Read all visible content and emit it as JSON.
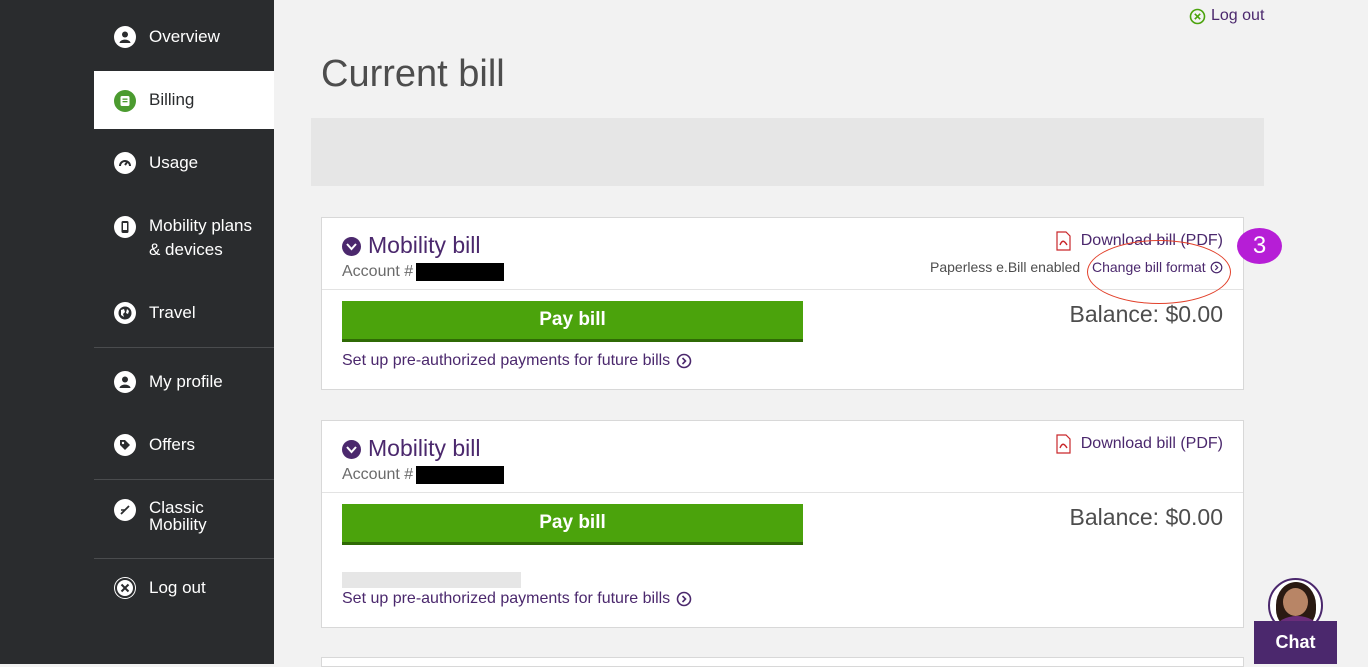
{
  "sidebar": {
    "items": [
      {
        "label": "Overview",
        "icon": "user-icon"
      },
      {
        "label": "Billing",
        "icon": "bill-icon",
        "active": true
      },
      {
        "label": "Usage",
        "icon": "gauge-icon"
      },
      {
        "label": "Mobility plans\n& devices",
        "icon": "device-icon"
      },
      {
        "label": "Travel",
        "icon": "globe-icon"
      },
      {
        "label": "My profile",
        "icon": "profile-icon"
      },
      {
        "label": "Offers",
        "icon": "tag-icon"
      },
      {
        "label": "Classic\nMobility",
        "icon": "classic-icon"
      },
      {
        "label": "Log out",
        "icon": "close-circle-icon"
      }
    ]
  },
  "header": {
    "logout_label": "Log out",
    "page_title": "Current bill"
  },
  "bills": [
    {
      "title": "Mobility bill",
      "account_label": "Account #",
      "download_label": "Download bill (PDF)",
      "paperless_label": "Paperless e.Bill enabled",
      "change_format_label": "Change bill format",
      "pay_label": "Pay bill",
      "balance_label": "Balance: $0.00",
      "setup_label": "Set up pre-authorized payments for future bills"
    },
    {
      "title": "Mobility bill",
      "account_label": "Account #",
      "download_label": "Download bill (PDF)",
      "pay_label": "Pay bill",
      "balance_label": "Balance: $0.00",
      "setup_label": "Set up pre-authorized payments for future bills"
    }
  ],
  "annotation": {
    "step_number": "3"
  },
  "chat": {
    "label": "Chat"
  },
  "colors": {
    "brand_purple": "#4b286d",
    "pay_green": "#4ba30c",
    "sidebar_bg": "#2a2c2e",
    "active_icon": "#4b9b2f",
    "annotation_badge": "#b61ed6"
  }
}
